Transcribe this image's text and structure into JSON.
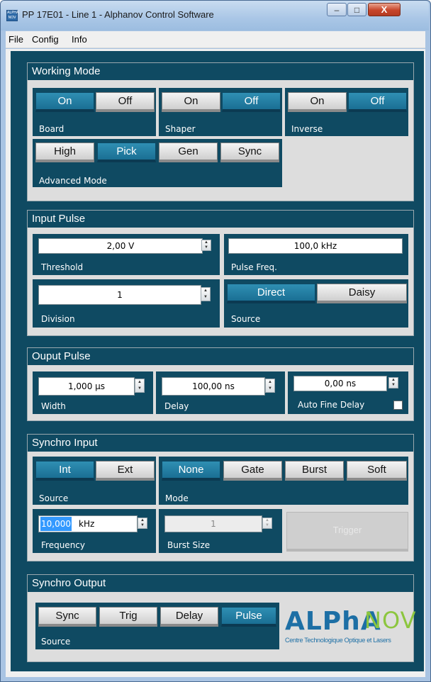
{
  "window": {
    "title": "PP 17E01 - Line 1 - Alphanov Control Software",
    "icon_text": "ALPHA NOV",
    "min_label": "–",
    "max_label": "□",
    "close_label": "X"
  },
  "menu": [
    "File",
    "Config",
    "Info"
  ],
  "working_mode": {
    "title": "Working Mode",
    "board": {
      "label": "Board",
      "on": "On",
      "off": "Off",
      "selected": "On"
    },
    "shaper": {
      "label": "Shaper",
      "on": "On",
      "off": "Off",
      "selected": "Off"
    },
    "inverse": {
      "label": "Inverse",
      "on": "On",
      "off": "Off",
      "selected": "Off"
    },
    "advanced": {
      "label": "Advanced Mode",
      "options": [
        "High",
        "Pick",
        "Gen",
        "Sync"
      ],
      "selected": "Pick"
    }
  },
  "input_pulse": {
    "title": "Input Pulse",
    "threshold": {
      "label": "Threshold",
      "value": "2,00 V"
    },
    "pulse_freq": {
      "label": "Pulse Freq.",
      "value": "100,0 kHz"
    },
    "division": {
      "label": "Division",
      "value": "1"
    },
    "source": {
      "label": "Source",
      "options": [
        "Direct",
        "Daisy"
      ],
      "selected": "Direct"
    }
  },
  "output_pulse": {
    "title": "Ouput Pulse",
    "width": {
      "label": "Width",
      "value": "1,000 µs"
    },
    "delay": {
      "label": "Delay",
      "value": "100,00 ns"
    },
    "auto_fine_delay": {
      "label": "Auto Fine Delay",
      "value": "0,00 ns",
      "checked": false
    }
  },
  "synchro_input": {
    "title": "Synchro Input",
    "source": {
      "label": "Source",
      "options": [
        "Int",
        "Ext"
      ],
      "selected": "Int"
    },
    "mode": {
      "label": "Mode",
      "options": [
        "None",
        "Gate",
        "Burst",
        "Soft"
      ],
      "selected": "None"
    },
    "frequency": {
      "label": "Frequency",
      "value_selected": "10,000",
      "unit": "kHz"
    },
    "burst_size": {
      "label": "Burst Size",
      "value": "1"
    },
    "trigger_label": "Trigger"
  },
  "synchro_output": {
    "title": "Synchro Output",
    "source": {
      "label": "Source",
      "options": [
        "Sync",
        "Trig",
        "Delay",
        "Pulse"
      ],
      "selected": "Pulse"
    }
  },
  "logo": {
    "text_alpha": "ALPhA",
    "text_nov": "NOV",
    "tagline": "Centre Technologique Optique et Lasers"
  },
  "colors": {
    "accent": "#0f4a62",
    "button_on": "#1a6f94",
    "logo_blue": "#1d6fa5",
    "logo_green": "#8cc63f"
  }
}
